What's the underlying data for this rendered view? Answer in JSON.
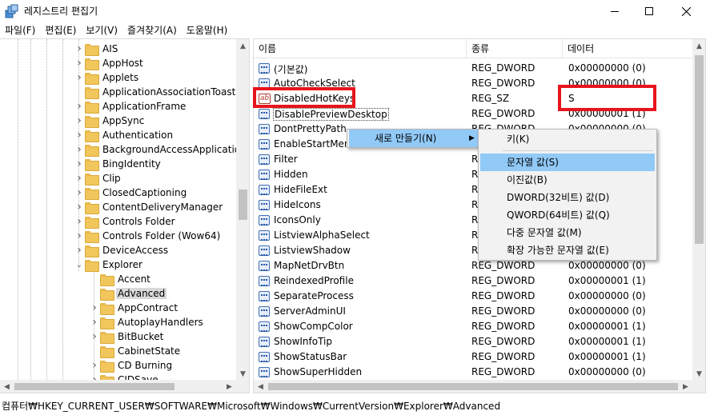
{
  "window": {
    "title": "레지스트리 편집기",
    "controls": [
      "minimize-icon",
      "maximize-icon",
      "close-icon"
    ]
  },
  "menu": [
    {
      "label": "파일(F)"
    },
    {
      "label": "편집(E)"
    },
    {
      "label": "보기(V)"
    },
    {
      "label": "즐겨찾기(A)"
    },
    {
      "label": "도움말(H)"
    }
  ],
  "tree": {
    "items": [
      {
        "label": "AIS",
        "expander": "collapsed"
      },
      {
        "label": "AppHost",
        "expander": "collapsed"
      },
      {
        "label": "Applets",
        "expander": "collapsed"
      },
      {
        "label": "ApplicationAssociationToasts",
        "expander": "none"
      },
      {
        "label": "ApplicationFrame",
        "expander": "collapsed"
      },
      {
        "label": "AppSync",
        "expander": "collapsed"
      },
      {
        "label": "Authentication",
        "expander": "collapsed"
      },
      {
        "label": "BackgroundAccessApplications",
        "expander": "collapsed"
      },
      {
        "label": "BingIdentity",
        "expander": "collapsed"
      },
      {
        "label": "Clip",
        "expander": "collapsed"
      },
      {
        "label": "ClosedCaptioning",
        "expander": "collapsed"
      },
      {
        "label": "ContentDeliveryManager",
        "expander": "collapsed"
      },
      {
        "label": "Controls Folder",
        "expander": "collapsed"
      },
      {
        "label": "Controls Folder (Wow64)",
        "expander": "collapsed"
      },
      {
        "label": "DeviceAccess",
        "expander": "collapsed"
      },
      {
        "label": "Explorer",
        "expander": "expanded"
      },
      {
        "label": "Accent",
        "expander": "none",
        "child": true
      },
      {
        "label": "Advanced",
        "expander": "none",
        "child": true,
        "selected": true
      },
      {
        "label": "AppContract",
        "expander": "collapsed",
        "child": true
      },
      {
        "label": "AutoplayHandlers",
        "expander": "collapsed",
        "child": true
      },
      {
        "label": "BitBucket",
        "expander": "collapsed",
        "child": true
      },
      {
        "label": "CabinetState",
        "expander": "none",
        "child": true
      },
      {
        "label": "CD Burning",
        "expander": "collapsed",
        "child": true
      },
      {
        "label": "CIDSave",
        "expander": "collapsed",
        "child": true
      }
    ]
  },
  "list": {
    "columns": [
      "이름",
      "종류",
      "데이터"
    ],
    "rows": [
      {
        "name": "(기본값)",
        "type": "REG_DWORD",
        "data": "0x00000000 (0)",
        "icon": "dword"
      },
      {
        "name": "AutoCheckSelect",
        "type": "REG_DWORD",
        "data": "0x00000000 (0)",
        "icon": "dword"
      },
      {
        "name": "DisabledHotKeys",
        "type": "REG_SZ",
        "data": "S",
        "icon": "sz",
        "highlight": true
      },
      {
        "name": "DisablePreviewDesktop",
        "type": "REG_DWORD",
        "data": "0x00000001 (1)",
        "icon": "dword",
        "focus": true
      },
      {
        "name": "DontPrettyPath",
        "type": "REG_DWORD",
        "data": "0x00000000 (0)",
        "icon": "dword"
      },
      {
        "name": "EnableStartMenu",
        "type": "R",
        "data": "",
        "icon": "dword"
      },
      {
        "name": "Filter",
        "type": "R",
        "data": "",
        "icon": "dword"
      },
      {
        "name": "Hidden",
        "type": "R",
        "data": "",
        "icon": "dword"
      },
      {
        "name": "HideFileExt",
        "type": "R",
        "data": "",
        "icon": "dword"
      },
      {
        "name": "HideIcons",
        "type": "R",
        "data": "",
        "icon": "dword"
      },
      {
        "name": "IconsOnly",
        "type": "R",
        "data": "",
        "icon": "dword"
      },
      {
        "name": "ListviewAlphaSelect",
        "type": "R",
        "data": "",
        "icon": "dword"
      },
      {
        "name": "ListviewShadow",
        "type": "R",
        "data": "",
        "icon": "dword"
      },
      {
        "name": "MapNetDrvBtn",
        "type": "REG_DWORD",
        "data": "0x00000000 (0)",
        "icon": "dword"
      },
      {
        "name": "ReindexedProfile",
        "type": "REG_DWORD",
        "data": "0x00000001 (1)",
        "icon": "dword"
      },
      {
        "name": "SeparateProcess",
        "type": "REG_DWORD",
        "data": "0x00000000 (0)",
        "icon": "dword"
      },
      {
        "name": "ServerAdminUI",
        "type": "REG_DWORD",
        "data": "0x00000000 (0)",
        "icon": "dword"
      },
      {
        "name": "ShowCompColor",
        "type": "REG_DWORD",
        "data": "0x00000001 (1)",
        "icon": "dword"
      },
      {
        "name": "ShowInfoTip",
        "type": "REG_DWORD",
        "data": "0x00000001 (1)",
        "icon": "dword"
      },
      {
        "name": "ShowStatusBar",
        "type": "REG_DWORD",
        "data": "0x00000001 (1)",
        "icon": "dword"
      },
      {
        "name": "ShowSuperHidden",
        "type": "REG_DWORD",
        "data": "0x00000000 (0)",
        "icon": "dword"
      }
    ]
  },
  "context_menu": {
    "item": "새로 만들기(N)",
    "submenu": [
      {
        "label": "키(K)"
      },
      {
        "label": "문자열 값(S)",
        "highlighted": true
      },
      {
        "label": "이진값(B)"
      },
      {
        "label": "DWORD(32비트) 값(D)"
      },
      {
        "label": "QWORD(64비트) 값(Q)"
      },
      {
        "label": "다중 문자열 값(M)"
      },
      {
        "label": "확장 가능한 문자열 값(E)"
      }
    ]
  },
  "status": {
    "path": "컴퓨터₩HKEY_CURRENT_USER₩SOFTWARE₩Microsoft₩Windows₩CurrentVersion₩Explorer₩Advanced"
  },
  "colors": {
    "menu_highlight": "#91c9f7",
    "annotation_red": "#e8141c",
    "folder": "#f1c65b"
  }
}
